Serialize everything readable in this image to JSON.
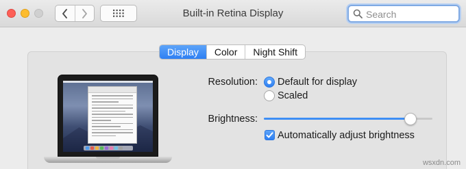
{
  "window": {
    "title": "Built-in Retina Display",
    "search_placeholder": "Search"
  },
  "tabs": [
    {
      "label": "Display",
      "active": true
    },
    {
      "label": "Color",
      "active": false
    },
    {
      "label": "Night Shift",
      "active": false
    }
  ],
  "resolution": {
    "label": "Resolution:",
    "options": [
      {
        "label": "Default for display",
        "selected": true
      },
      {
        "label": "Scaled",
        "selected": false
      }
    ]
  },
  "brightness": {
    "label": "Brightness:",
    "value_fraction": 0.9,
    "auto_adjust_label": "Automatically adjust brightness",
    "auto_adjust_checked": true
  },
  "icons": [
    "back-chevron-icon",
    "forward-chevron-icon",
    "show-all-grid-icon",
    "search-icon",
    "checkmark-icon"
  ],
  "colors": {
    "accent": "#2d7ff3",
    "close": "#fd5f57",
    "minimize": "#fdbc2e"
  },
  "watermark": "wsxdn.com"
}
